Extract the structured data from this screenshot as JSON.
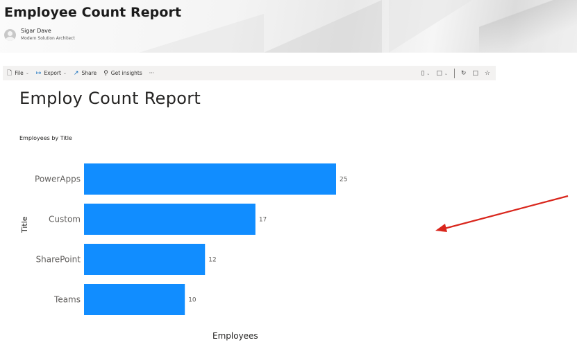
{
  "header": {
    "site_title": "Employee Count Report",
    "author_name": "Sigar Dave",
    "author_role": "Modern Solution Architect"
  },
  "toolbar": {
    "file_label": "File",
    "export_label": "Export",
    "share_label": "Share",
    "insights_label": "Get insights",
    "more_label": "···"
  },
  "report": {
    "title": "Employ Count Report"
  },
  "colors": {
    "bar": "#118dff",
    "arrow": "#d9261c"
  },
  "chart_data": {
    "type": "bar",
    "orientation": "horizontal",
    "title": "Employees by Title",
    "xlabel": "Employees",
    "ylabel": "Title",
    "categories": [
      "PowerApps",
      "Custom",
      "SharePoint",
      "Teams"
    ],
    "values": [
      25,
      17,
      12,
      10
    ],
    "xlim": [
      0,
      25
    ],
    "data_labels": true,
    "grid": false
  }
}
